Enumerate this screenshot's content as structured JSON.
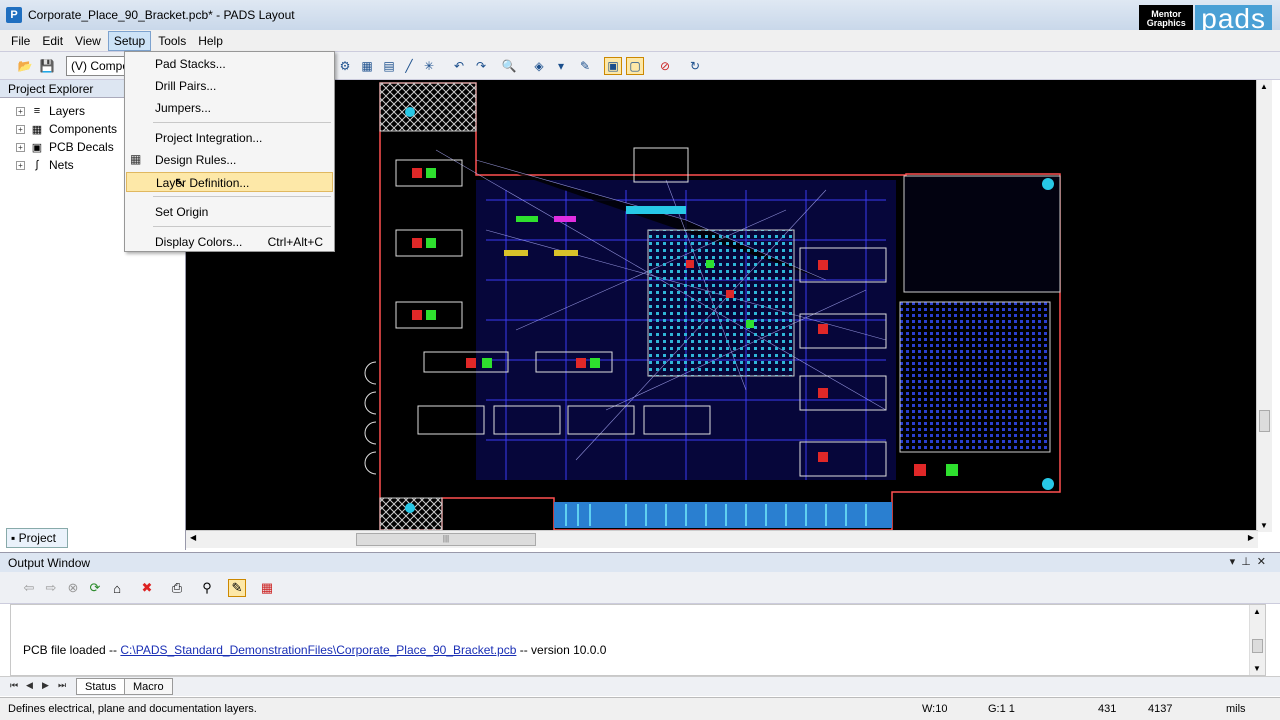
{
  "window": {
    "title": "Corporate_Place_90_Bracket.pcb* - PADS Layout",
    "app_icon": "pads-icon"
  },
  "brand": {
    "company": "Mentor Graphics",
    "product": "pads"
  },
  "menubar": {
    "items": [
      "File",
      "Edit",
      "View",
      "Setup",
      "Tools",
      "Help"
    ],
    "active": "Setup"
  },
  "toolbar": {
    "layer_combo": "(V) Compo"
  },
  "project_explorer": {
    "title": "Project Explorer",
    "items": [
      "Layers",
      "Components",
      "PCB Decals",
      "Nets"
    ],
    "tab": "Project"
  },
  "setup_menu": {
    "items": [
      {
        "label": "Pad Stacks...",
        "shortcut": ""
      },
      {
        "label": "Drill Pairs...",
        "shortcut": ""
      },
      {
        "label": "Jumpers...",
        "shortcut": ""
      },
      {
        "label": "Project Integration...",
        "shortcut": ""
      },
      {
        "label": "Design Rules...",
        "shortcut": ""
      },
      {
        "label": "Layer Definition...",
        "shortcut": ""
      },
      {
        "label": "Set Origin",
        "shortcut": ""
      },
      {
        "label": "Display Colors...",
        "shortcut": "Ctrl+Alt+C"
      }
    ],
    "highlighted": "Layer Definition..."
  },
  "output_window": {
    "title": "Output Window",
    "message_prefix": "PCB file loaded --",
    "message_link": "C:\\PADS_Standard_DemonstrationFiles\\Corporate_Place_90_Bracket.pcb",
    "message_suffix": "-- version 10.0.0",
    "tabs": [
      "Status",
      "Macro"
    ],
    "active_tab": "Status"
  },
  "statusbar": {
    "hint": "Defines electrical, plane and documentation layers.",
    "width": "W:10",
    "grid": "G:1 1",
    "x": "431",
    "y": "4137",
    "units": "mils"
  },
  "colors": {
    "board_outline": "#ff4040",
    "trace": "#3a3af0",
    "pad": "#27c8e6",
    "selected": "#fde8a8"
  }
}
